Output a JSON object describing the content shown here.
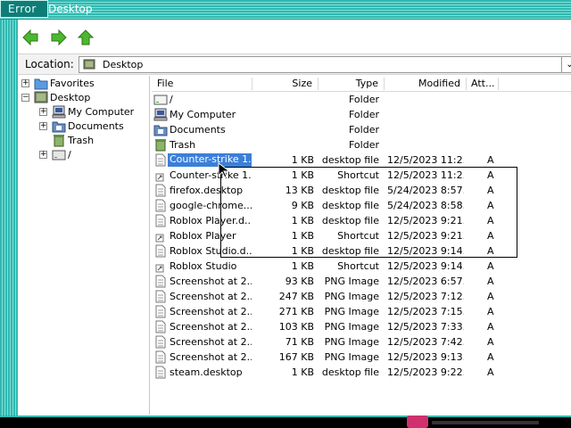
{
  "window": {
    "title": "Desktop",
    "error_tab": "Error"
  },
  "toolbar": {
    "back_icon": "back-arrow-icon",
    "forward_icon": "forward-arrow-icon",
    "up_icon": "up-arrow-icon"
  },
  "location": {
    "label": "Location:",
    "value": "Desktop",
    "icon": "desktop-icon"
  },
  "tree": [
    {
      "label": "Favorites",
      "icon": "folder-blue-icon",
      "expander": "+"
    },
    {
      "label": "Desktop",
      "icon": "desktop-icon",
      "expander": "−"
    },
    {
      "label": "My Computer",
      "icon": "computer-icon",
      "expander": "+"
    },
    {
      "label": "Documents",
      "icon": "documents-icon",
      "expander": "+"
    },
    {
      "label": "Trash",
      "icon": "trash-icon",
      "expander": ""
    },
    {
      "label": "/",
      "icon": "drive-icon",
      "expander": "+"
    }
  ],
  "columns": {
    "file": "File",
    "size": "Size",
    "type": "Type",
    "modified": "Modified",
    "attr": "Att..."
  },
  "rows": [
    {
      "name": "/",
      "size": "",
      "type": "Folder",
      "modified": "",
      "attr": "",
      "icon": "drive-icon"
    },
    {
      "name": "My Computer",
      "size": "",
      "type": "Folder",
      "modified": "",
      "attr": "",
      "icon": "computer-icon"
    },
    {
      "name": "Documents",
      "size": "",
      "type": "Folder",
      "modified": "",
      "attr": "",
      "icon": "documents-icon"
    },
    {
      "name": "Trash",
      "size": "",
      "type": "Folder",
      "modified": "",
      "attr": "",
      "icon": "trash-icon"
    },
    {
      "name": "Counter-strike 1...",
      "size": "1 KB",
      "type": "desktop file",
      "modified": "12/5/2023 11:2...",
      "attr": "A",
      "icon": "desktop-file-icon",
      "selected": true
    },
    {
      "name": "Counter-strike 1...",
      "size": "1 KB",
      "type": "Shortcut",
      "modified": "12/5/2023 11:2...",
      "attr": "A",
      "icon": "shortcut-icon"
    },
    {
      "name": "firefox.desktop",
      "size": "13 KB",
      "type": "desktop file",
      "modified": "5/24/2023 8:57...",
      "attr": "A",
      "icon": "desktop-file-icon"
    },
    {
      "name": "google-chrome....",
      "size": "9 KB",
      "type": "desktop file",
      "modified": "5/24/2023 8:58...",
      "attr": "A",
      "icon": "desktop-file-icon"
    },
    {
      "name": "Roblox Player.d...",
      "size": "1 KB",
      "type": "desktop file",
      "modified": "12/5/2023 9:21...",
      "attr": "A",
      "icon": "desktop-file-icon"
    },
    {
      "name": "Roblox Player",
      "size": "1 KB",
      "type": "Shortcut",
      "modified": "12/5/2023 9:21...",
      "attr": "A",
      "icon": "shortcut-icon"
    },
    {
      "name": "Roblox Studio.d...",
      "size": "1 KB",
      "type": "desktop file",
      "modified": "12/5/2023 9:14...",
      "attr": "A",
      "icon": "desktop-file-icon"
    },
    {
      "name": "Roblox Studio",
      "size": "1 KB",
      "type": "Shortcut",
      "modified": "12/5/2023 9:14...",
      "attr": "A",
      "icon": "shortcut-icon"
    },
    {
      "name": "Screenshot at 2...",
      "size": "93 KB",
      "type": "PNG Image",
      "modified": "12/5/2023 6:57...",
      "attr": "A",
      "icon": "image-file-icon"
    },
    {
      "name": "Screenshot at 2...",
      "size": "247 KB",
      "type": "PNG Image",
      "modified": "12/5/2023 7:12...",
      "attr": "A",
      "icon": "image-file-icon"
    },
    {
      "name": "Screenshot at 2...",
      "size": "271 KB",
      "type": "PNG Image",
      "modified": "12/5/2023 7:15...",
      "attr": "A",
      "icon": "image-file-icon"
    },
    {
      "name": "Screenshot at 2...",
      "size": "103 KB",
      "type": "PNG Image",
      "modified": "12/5/2023 7:33...",
      "attr": "A",
      "icon": "image-file-icon"
    },
    {
      "name": "Screenshot at 2...",
      "size": "71 KB",
      "type": "PNG Image",
      "modified": "12/5/2023 7:42...",
      "attr": "A",
      "icon": "image-file-icon"
    },
    {
      "name": "Screenshot at 2...",
      "size": "167 KB",
      "type": "PNG Image",
      "modified": "12/5/2023 9:13...",
      "attr": "A",
      "icon": "image-file-icon"
    },
    {
      "name": "steam.desktop",
      "size": "1 KB",
      "type": "desktop file",
      "modified": "12/5/2023 9:22...",
      "attr": "A",
      "icon": "desktop-file-icon"
    }
  ],
  "colors": {
    "titlebar": "#2fb9b0",
    "selection": "#3b7fd9",
    "nav_arrow": "#4cb82e"
  }
}
